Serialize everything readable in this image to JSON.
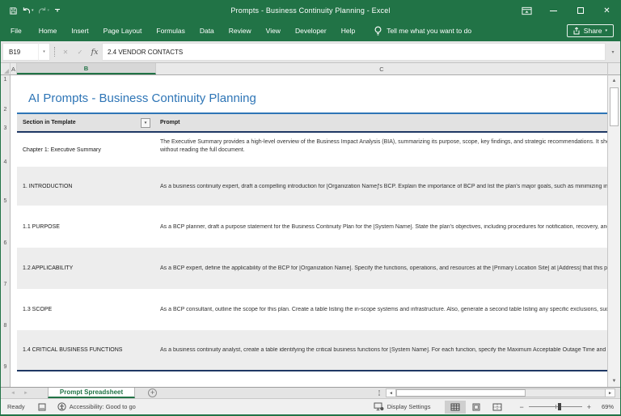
{
  "window": {
    "title": "Prompts - Business Continuity Planning - Excel",
    "accent_color": "#217346"
  },
  "icons": {
    "dropdown": "▾",
    "left_arrow": "◄",
    "right_arrow": "►",
    "up_arrow": "▲",
    "down_arrow": "▼",
    "cancel": "✕",
    "enter": "✓",
    "fx": "fx",
    "close": "✕",
    "add_sheet": "+",
    "plus": "+",
    "minus": "−"
  },
  "ribbon": {
    "tabs": [
      "File",
      "Home",
      "Insert",
      "Page Layout",
      "Formulas",
      "Data",
      "Review",
      "View",
      "Developer",
      "Help"
    ],
    "tell_me": "Tell me what you want to do",
    "share": "Share"
  },
  "formula_bar": {
    "cell_reference": "B19",
    "formula": "2.4 VENDOR CONTACTS"
  },
  "grid": {
    "column_headers": [
      "A",
      "B",
      "C"
    ],
    "selected_column": "B",
    "row_numbers": [
      1,
      2,
      3,
      4,
      5,
      6,
      7,
      8,
      9
    ],
    "sheet_title": "AI Prompts - Business Continuity Planning",
    "table": {
      "section_header": "Section in Template",
      "prompt_header": "Prompt",
      "rows": [
        {
          "section": "Chapter 1: Executive Summary",
          "prompt": "The Executive Summary provides a high-level overview of the Business Impact Analysis (BIA), summarizing its purpose, scope, key findings, and strategic recommendations. It should",
          "prompt_line2": "without reading the full document."
        },
        {
          "section": "1. INTRODUCTION",
          "prompt": "As a business continuity expert, draft a compelling introduction for [Organization Name]'s BCP. Explain the importance of BCP and list the plan's major goals, such as minimizing inte"
        },
        {
          "section": "1.1 PURPOSE",
          "prompt": "As a BCP planner, draft a purpose statement for the Business Continuity Plan for the [System Name]. State the plan's objectives, including procedures for notification, recovery, and"
        },
        {
          "section": "1.2 APPLICABILITY",
          "prompt": "As a BCP expert, define the applicability of the BCP for [Organization Name]. Specify the functions, operations, and resources at the [Primary Location Site] at [Address] that this pla"
        },
        {
          "section": "1.3 SCOPE",
          "prompt": "As a BCP consultant, outline the scope for this plan. Create a table listing the in-scope systems and infrastructure. Also, generate a second table listing any specific exclusions, such"
        },
        {
          "section": "1.4 CRITICAL BUSINESS FUNCTIONS",
          "prompt": "As a business continuity analyst, create a table identifying the critical business functions for [System Name]. For each function, specify the Maximum Acceptable Outage Time and its"
        }
      ]
    }
  },
  "sheet_tabs": {
    "active_tab": "Prompt Spreadsheet"
  },
  "status_bar": {
    "mode": "Ready",
    "accessibility": "Accessibility: Good to go",
    "display_settings": "Display Settings",
    "zoom_level": "69%"
  }
}
